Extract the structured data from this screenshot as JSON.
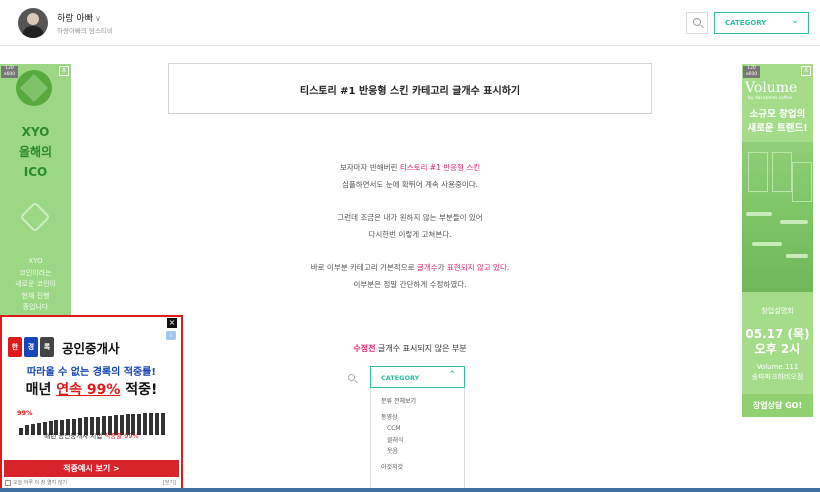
{
  "header": {
    "blog_name": "하랑 아빠",
    "blog_subtitle": "하랑아빠의 맘스티비",
    "category_button": "CATEGORY",
    "icons": [
      "avatar",
      "chevron-down-icon",
      "search-icon"
    ]
  },
  "article": {
    "title": "티스토리 #1 반응형 스킨 카테고리 글개수 표시하기",
    "p1_before": "보자마자 반해버린 ",
    "p1_link": "티스토리 #1 반응형 스킨",
    "p1_line2": "심플하면서도 눈에 확뛰어 계속 사용중이다.",
    "p2_line1": "그런데 조금은 내가 원하지 않는 부분들이 있어",
    "p2_line2": "다시한번 이렇게 고쳐본다.",
    "p3_before": "바로 이부분 카테고리 기본적으로 ",
    "p3_pink1": "글개수",
    "p3_mid": "가 ",
    "p3_pink2": "표현되지 않고 있다.",
    "p3_line2": "이부분은 정말 간단하게 수정하였다.",
    "sub_pink": "수정전",
    "sub_rest": " 글개수 표시되지 않은 부분"
  },
  "sample": {
    "category_button": "CATEGORY",
    "menu_items": [
      {
        "label": "분류 전체보기",
        "child": false
      },
      {
        "label": "동영상",
        "child": false
      },
      {
        "label": "CCM",
        "child": true
      },
      {
        "label": "클래식",
        "child": true
      },
      {
        "label": "웃음",
        "child": true
      },
      {
        "label": "이것저것",
        "child": false
      }
    ]
  },
  "ad_left": {
    "badge": "120 x600",
    "close": "X",
    "title_lines": [
      "XYO",
      "올해의",
      "ICO"
    ],
    "small_lines": [
      "XYO",
      "코인이라는",
      "새로운 코인이",
      "현재 진행",
      "중입니다"
    ]
  },
  "ad_right": {
    "badge": "120 x600",
    "close": "X",
    "brand": "Volume",
    "brand_sub": "by dal.komm coffee",
    "slogan_lines": [
      "소규모 창업의",
      "새로운 트랜드!"
    ],
    "event": "창업설명회",
    "date_lines": [
      "05.17 (목)",
      "오후 2시"
    ],
    "place_lines": [
      "Volume.111",
      "송파파크하비오점"
    ],
    "cta": "창업상담 GO!"
  },
  "ad_popup": {
    "close": "×",
    "info": "i",
    "book_labels": [
      "한",
      "경",
      "록"
    ],
    "brand": "공인중개사",
    "line1": "따라올 수 없는 경록의 적중률!",
    "line2_before": "매년 ",
    "line2_hl": "연속 99%",
    "line2_after": " 적중!",
    "percent": "99%",
    "bars": [
      0.3,
      0.45,
      0.5,
      0.55,
      0.6,
      0.62,
      0.66,
      0.7,
      0.72,
      0.75,
      0.78,
      0.8,
      0.82,
      0.84,
      0.86,
      0.88,
      0.9,
      0.92,
      0.94,
      0.95,
      0.97,
      0.98,
      0.99,
      1.0,
      1.0
    ],
    "line3_before": "매년 공인중개사 시험 ",
    "line3_hl": "적중률 99%",
    "cta": "적중예시 보기 >",
    "foot": "오늘 하루 이 창 열지 않기",
    "foot_close": "[닫기]"
  }
}
